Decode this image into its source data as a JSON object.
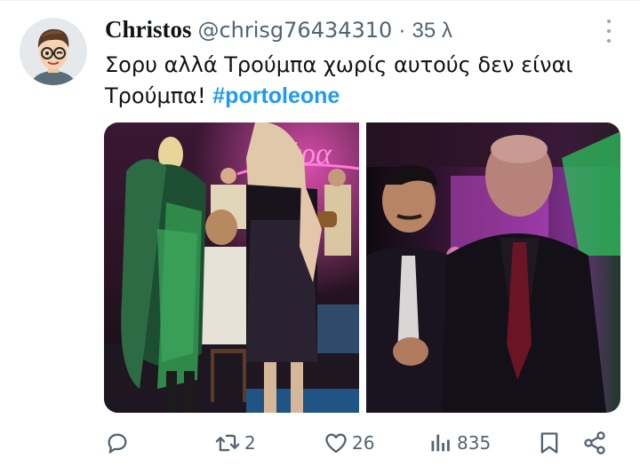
{
  "tweet": {
    "author_name": "Christos",
    "author_handle": "@chrisg76434310",
    "separator": "·",
    "time": "35 λ",
    "text": "Σορυ αλλά Τρούμπα χωρίς αυτούς δεν είναι Τρούμπα!",
    "hashtag": "#portoleone"
  },
  "media": {
    "count": 2,
    "sign_text": "...κάρα"
  },
  "actions": {
    "reply_count": "",
    "retweet_count": "2",
    "like_count": "26",
    "view_count": "835"
  },
  "colors": {
    "accent": "#1d9bf0",
    "muted": "#536471",
    "text": "#0f1419"
  },
  "icons": [
    "avatar",
    "more-icon",
    "reply-icon",
    "retweet-icon",
    "like-icon",
    "views-icon",
    "bookmark-icon",
    "share-icon"
  ]
}
